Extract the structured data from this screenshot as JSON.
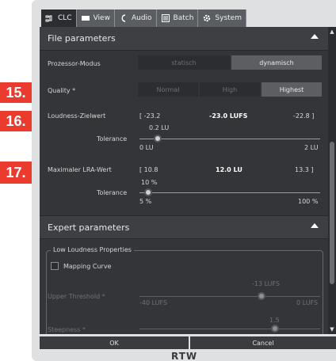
{
  "tabs": [
    {
      "label": "CLC",
      "icon": "clc-icon",
      "active": true
    },
    {
      "label": "View",
      "icon": "view-icon",
      "active": false
    },
    {
      "label": "Audio",
      "icon": "audio-icon",
      "active": false
    },
    {
      "label": "Batch",
      "icon": "batch-icon",
      "active": false
    },
    {
      "label": "System",
      "icon": "gear-icon",
      "active": false
    }
  ],
  "file_parameters": {
    "title": "File parameters",
    "prozessor_modus": {
      "label": "Prozessor-Modus",
      "options": [
        "statisch",
        "dynamisch"
      ],
      "selected": "dynamisch"
    },
    "quality": {
      "label": "Quality *",
      "options": [
        "Normal",
        "High",
        "Highest"
      ],
      "selected": "Highest"
    },
    "loudness": {
      "label": "Loudness-Zielwert",
      "min": "[ -23.2",
      "current": "-23.0 LUFS",
      "max": "-22.8 ]",
      "tolerance_label": "Tolerance",
      "tolerance_value": "0.2 LU",
      "scale_min": "0 LU",
      "scale_max": "2 LU",
      "tolerance_fraction": 0.1
    },
    "lra": {
      "label": "Maximaler LRA-Wert",
      "min": "[ 10.8",
      "current": "12.0 LU",
      "max": "13.3 ]",
      "tolerance_label": "Tolerance",
      "tolerance_value": "10 %",
      "scale_min": "5 %",
      "scale_max": "100 %",
      "tolerance_fraction": 0.05
    }
  },
  "expert_parameters": {
    "title": "Expert parameters",
    "group_title": "Low Loudness Properties",
    "mapping_curve_label": "Mapping Curve",
    "mapping_curve_checked": false,
    "upper_threshold": {
      "label": "Upper Threshold *",
      "value": "-13 LUFS",
      "scale_min": "-40 LUFS",
      "scale_max": "0 LUFS",
      "fraction": 0.675
    },
    "steepness": {
      "label": "Steepness *",
      "value": "1.5",
      "fraction": 0.75
    }
  },
  "buttons": {
    "ok": "OK",
    "cancel": "Cancel"
  },
  "logo": "RTW",
  "badges": [
    "15.",
    "16.",
    "17."
  ],
  "colors": {
    "accent_badge": "#ea3b2e",
    "panel_bg": "#333538",
    "selected_option": "#5b5e62"
  }
}
